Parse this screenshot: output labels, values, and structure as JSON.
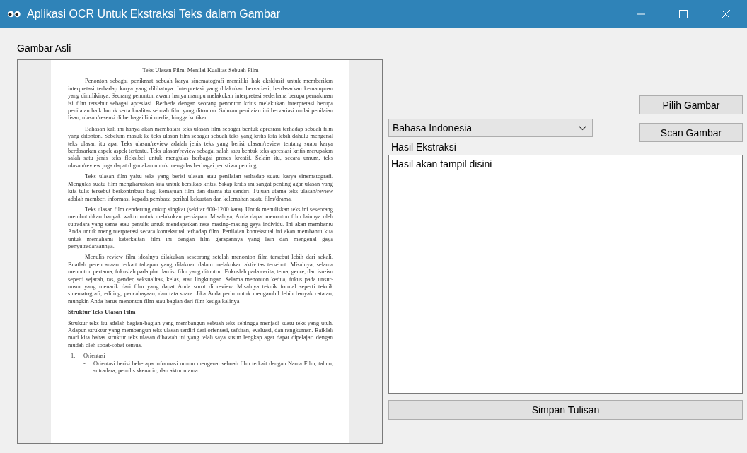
{
  "window": {
    "title": "Aplikasi OCR Untuk Ekstraksi Teks dalam Gambar"
  },
  "image_panel": {
    "label": "Gambar Asli",
    "document": {
      "title": "Teks Ulasan Film: Menilai Kualitas Sebuah Film",
      "paragraphs": [
        {
          "kind": "indent",
          "text": "Penonton sebagai penikmat sebuah karya sinematografi memiliki hak eksklusif untuk memberikan interpretasi terhadap karya yang dilihatnya. Interpretasi yang dilakukan bervariasi, berdasarkan kemampuan yang dimilikinya. Seorang penonton awam hanya mampu melakukan interpretasi sederhana berupa pemaknaan isi film tersebut sebagai apresiasi. Berbeda dengan seorang penonton kritis melakukan interpretasi berupa penilaian baik buruk serta kualitas sebuah film yang ditonton. Saluran penilaian ini bervariasi mulai penilaian lisan, ulasan/resensi di berbagai lini media, hingga kritikan."
        },
        {
          "kind": "indent",
          "text": "Bahasan kali ini hanya akan membatasi teks ulasan film sebagai bentuk apresiasi terhadap sebuah film yang ditonton. Sebelum masuk ke teks ulasan film sebagai sebuah teks yang kritis kita lebih dahulu mengenal teks ulasan itu apa. Teks ulasan/review adalah jenis teks yang berisi ulasan/review tentang suatu karya berdasarkan aspek-aspek tertentu. Teks ulasan/review sebagai salah satu bentuk teks apresiasi kritis merupakan salah satu jenis teks fleksibel untuk mengulas berbagai proses kreatif. Selain itu, secara umum, teks ulasan/review juga dapat digunakan untuk mengulas berbagai peristiwa penting."
        },
        {
          "kind": "indent",
          "text": "Teks ulasan film yaitu teks yang berisi ulasan atau penilaian terhadap suatu karya sinematografi. Mengulas suatu film mengharuskan kita untuk bersikap kritis. Sikap kritis ini sangat penting agar ulasan yang kita tulis tersebut berkontribusi bagi kemajuan film dan drama itu sendiri.  Tujuan utama teks ulasan/review adalah memberi informasi kepada pembaca perihal kekuatan dan kelemahan suatu film/drama."
        },
        {
          "kind": "indent",
          "text": "Teks ulasan film cenderung cukup singkat (sekitar 600-1200 kata). Untuk menuliskan teks ini seseorang membutuhkan banyak waktu untuk melakukan persiapan. Misalnya, Anda dapat menonton film lainnya oleh sutradara yang sama atau penulis untuk mendapatkan rasa masing-masing gaya individu. Ini akan membantu Anda untuk menginterpretasi secara kontekstual terhadap film. Penilaian kontekstual ini akan membantu kita untuk memahami keterkaitan film ini dengan film garapannya yang lain dan mengenal gaya penyutradaraannya."
        },
        {
          "kind": "indent",
          "text": "Menulis review film idealnya dilakukan seseorang setelah menonton film tersebut lebih dari sekali. Buatlah perencanaan terkait tahapan yang dilakuan dalam melakukan aktivitas tersebut. Misalnya, selama menonton pertama, fokuslah pada plot dan isi film yang ditonton. Fokuslah pada cerita, tema, genre, dan isu-isu seperti sejarah, ras, gender, seksualitas, kelas, atau lingkungan. Selama menonton kedua, fokus pada unsur-unsur yang menarik dari film yang dapat Anda sorot di review. Misalnya teknik formal seperti teknik sinematografi, editing, pencahayaan, dan tata suara. Jika Anda perlu untuk mengambil lebih banyak catatan, mungkin Anda harus menonton film atau bagian dari film ketiga kalinya"
        },
        {
          "kind": "heading",
          "text": "Struktur Teks Ulasan Film"
        },
        {
          "kind": "plain",
          "text": "Struktur teks itu adalah bagian-bagian yang membangun sebuah teks sehingga menjadi suatu teks yang utuh. Adapun struktur yang membangun teks ulasan terdiri dari orientasi, tafsiran, evaluasi, dan rangkuman. Baiklah mari kita bahas struktur teks ulasan dibawah ini yang telah saya susun lengkap agar dapat dipelajari dengan mudah oleh sobat-sobat semua."
        }
      ],
      "list_items": [
        {
          "number": "1.",
          "label": "Orientasi",
          "bullets": [
            {
              "marker": "-",
              "text": "Orientasi berisi beberapa informasi umum mengenai sebuah film terkait dengan Nama Film, tahun, sutradara, penulis skenario, dan aktor utama."
            }
          ]
        }
      ]
    }
  },
  "buttons_top": [
    "Pilih Gambar",
    "Scan Gambar"
  ],
  "language_select": {
    "value": "Bahasa Indonesia"
  },
  "result": {
    "label": "Hasil Ekstraksi",
    "value": "Hasil akan tampil disini"
  },
  "save_button": "Simpan Tulisan"
}
